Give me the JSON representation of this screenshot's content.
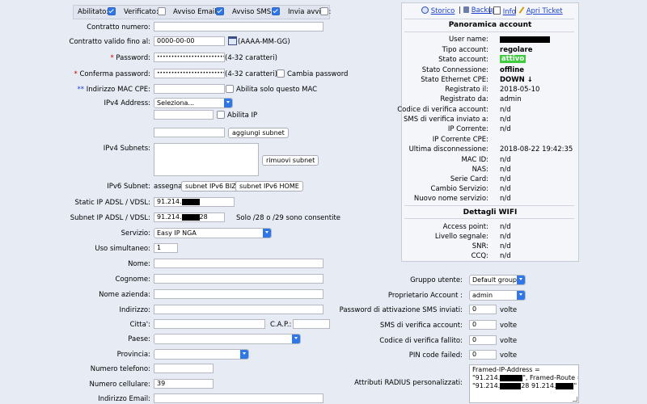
{
  "flags": {
    "abilitato": {
      "label": "Abilitato:",
      "checked": true
    },
    "verificato": {
      "label": "Verificato:",
      "checked": false
    },
    "avviso_email": {
      "label": "Avviso Email:",
      "checked": true
    },
    "avviso_sms": {
      "label": "Avviso SMS:",
      "checked": true
    },
    "invia_avviso": {
      "label": "Invia avviso:",
      "checked": false
    }
  },
  "form": {
    "contratto_numero": {
      "label": "Contratto numero:",
      "value": ""
    },
    "contratto_valido": {
      "label": "Contratto valido fino al:",
      "value": "0000-00-00",
      "hint": "(AAAA-MM-GG)"
    },
    "password": {
      "label": "Password:",
      "value": "••••••••••••••••••••••••••••••",
      "hint": "(4-32 caratteri)"
    },
    "conferma_password": {
      "label": "Conferma password:",
      "value": "••••••••••••••••••••••••••••••",
      "hint": "(4-32 caratteri)",
      "cambia_label": "Cambia password"
    },
    "mac": {
      "label": "Indirizzo MAC CPE:",
      "value": "",
      "abilita_label": "Abilita solo questo MAC"
    },
    "ipv4_address": {
      "label": "IPv4 Address:",
      "selected": "Seleziona...",
      "abilita_ip_label": "Abilita IP"
    },
    "aggiungi_subnet": "aggiungi subnet",
    "ipv4_subnets": {
      "label": "IPv4 Subnets:",
      "rimuovi": "rimuovi subnet"
    },
    "ipv6_subnet": {
      "label": "IPv6 Subnet:",
      "assegna": "assegna",
      "biz": "subnet IPv6 BIZ",
      "home": "subnet IPv6 HOME"
    },
    "static_ip": {
      "label": "Static IP ADSL / VDSL:",
      "value": "91.214."
    },
    "subnet_ip": {
      "label": "Subnet IP ADSL / VDSL:",
      "value_prefix": "91.214.",
      "value_suffix": "28",
      "hint": "Solo /28 o /29 sono consentite"
    },
    "servizio": {
      "label": "Servizio:",
      "selected": "Easy IP NGA"
    },
    "uso_simultaneo": {
      "label": "Uso simultaneo:",
      "value": "1"
    },
    "nome": {
      "label": "Nome:",
      "value": ""
    },
    "cognome": {
      "label": "Cognome:",
      "value": ""
    },
    "nome_azienda": {
      "label": "Nome azienda:",
      "value": ""
    },
    "indirizzo": {
      "label": "Indirizzo:",
      "value": ""
    },
    "citta": {
      "label": "Citta':",
      "value": ""
    },
    "cap": {
      "label": "C.A.P.:",
      "value": ""
    },
    "paese": {
      "label": "Paese:",
      "selected": ""
    },
    "provincia": {
      "label": "Provincia:",
      "selected": ""
    },
    "telefono": {
      "label": "Numero telefono:",
      "value": ""
    },
    "cellulare": {
      "label": "Numero cellulare:",
      "value": "39"
    },
    "email": {
      "label": "Indirizzo Email:",
      "value": ""
    }
  },
  "toolbar": {
    "storico": "Storico",
    "backup": "Backup",
    "info": "Info",
    "ticket": "Apri Ticket"
  },
  "account": {
    "title": "Panoramica account",
    "rows": [
      {
        "label": "User name:",
        "value": ""
      },
      {
        "label": "Tipo account:",
        "value": "regolare"
      },
      {
        "label": "Stato account:",
        "value": "attivo"
      },
      {
        "label": "Stato Connessione:",
        "value": "offline"
      },
      {
        "label": "Stato Ethernet CPE:",
        "value": "DOWN ↓"
      },
      {
        "label": "Registrato il:",
        "value": "2018-05-10"
      },
      {
        "label": "Registrato da:",
        "value": "admin"
      },
      {
        "label": "Codice di verifica account:",
        "value": "n/d"
      },
      {
        "label": "SMS di verifica inviato a:",
        "value": "n/d"
      },
      {
        "label": "IP Corrente:",
        "value": "n/d"
      },
      {
        "label": "IP Corrente CPE:",
        "value": ""
      },
      {
        "label": "Ultima disconnessione:",
        "value": "2018-08-22 19:42:35"
      },
      {
        "label": "MAC ID:",
        "value": "n/d"
      },
      {
        "label": "NAS:",
        "value": "n/d"
      },
      {
        "label": "Serie Card:",
        "value": "n/d"
      },
      {
        "label": "Cambio Servizio:",
        "value": "n/d"
      },
      {
        "label": "Nuovo nome servizio:",
        "value": "n/d"
      }
    ]
  },
  "wifi": {
    "title": "Dettagli WIFI",
    "rows": [
      {
        "label": "Access point:",
        "value": "n/d"
      },
      {
        "label": "Livello segnale:",
        "value": "n/d"
      },
      {
        "label": "SNR:",
        "value": "n/d"
      },
      {
        "label": "CCQ:",
        "value": "n/d"
      }
    ]
  },
  "right_form": {
    "gruppo": {
      "label": "Gruppo utente:",
      "selected": "Default group"
    },
    "proprietario": {
      "label": "Proprietario Account :",
      "selected": "admin"
    },
    "pwd_sms": {
      "label": "Password di attivazione SMS inviati:",
      "value": "0",
      "unit": "volte"
    },
    "sms_verifica": {
      "label": "SMS di verifica account:",
      "value": "0",
      "unit": "volte"
    },
    "codice_fallito": {
      "label": "Codice di verifica fallito:",
      "value": "0",
      "unit": "volte"
    },
    "pin_failed": {
      "label": "PIN code failed:",
      "value": "0",
      "unit": "volte"
    },
    "radius": {
      "label": "Attributi RADIUS personalizzati:",
      "line1": "Framed-IP-Address =",
      "line2a": "\"91.214.",
      "line2b": "\", Framed-Route =",
      "line3a": "\"91.214.",
      "line3b": "28 91.214.",
      "line3c": "\""
    }
  },
  "colors": {
    "active_bg": "#3ecb3e",
    "accent": "#2f76e6"
  }
}
